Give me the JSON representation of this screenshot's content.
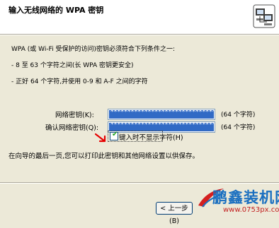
{
  "header": {
    "title": "输入无线网络的 WPA 密钥",
    "icon": "network-computers-icon"
  },
  "content": {
    "intro": "WPA (或 Wi-Fi 受保护的访问)密钥必须符合下列条件之一:",
    "bullet1": "- 8 至 63 个字符之间(长 WPA 密钥更安全)",
    "bullet2": "- 正好 64 个字符,并使用 0-9 和 A-F 之间的字符"
  },
  "form": {
    "key_label": "网络密钥(K):",
    "key_value": "************************************",
    "key_hint": "(64 个字符)",
    "confirm_label": "确认网络密钥(Q):",
    "confirm_value": "************************************",
    "confirm_hint": "(64 个字符)",
    "hide_label": "键入时不显示字符(H)",
    "hide_checked": true
  },
  "footnote": "在向导的最后一页,您可以打印此密钥和其他网络设置以供保存。",
  "buttons": {
    "back": "< 上一步(B)"
  },
  "watermark": {
    "brand": "鹏鑫装机网",
    "url": "www.0753px.com"
  }
}
